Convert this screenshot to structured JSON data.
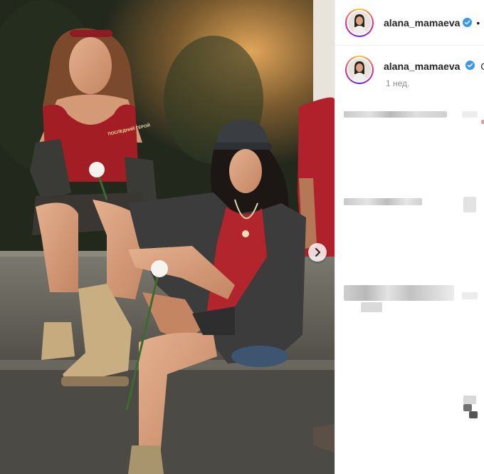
{
  "post": {
    "username": "alana_mamaeva",
    "header_dot": "•",
    "caption_start": "O",
    "timestamp": "1 нед."
  },
  "photo": {
    "tshirt_print": "ПОСЛЕДНИЙ ГЕРОЙ"
  },
  "colors": {
    "verified_badge": "#3897f0",
    "text": "#262626",
    "muted": "#8e8e8e",
    "border": "#efefef"
  },
  "icons": {
    "verified": "verified-badge-icon",
    "next": "chevron-right-icon"
  }
}
